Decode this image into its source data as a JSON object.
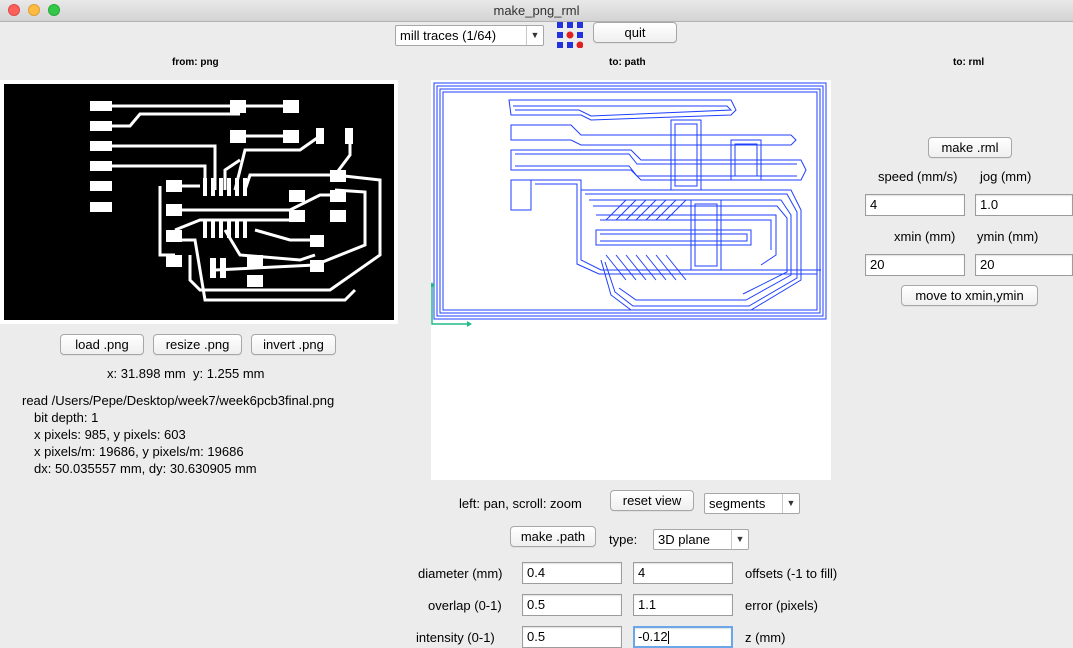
{
  "window": {
    "title": "make_png_rml"
  },
  "toolbar": {
    "process_select": "mill traces (1/64)",
    "quit_label": "quit"
  },
  "from_png": {
    "heading": "from: png",
    "buttons": {
      "load": "load .png",
      "resize": "resize .png",
      "invert": "invert .png"
    },
    "coords": "x: 31.898 mm  y: 1.255 mm",
    "info": [
      "read /Users/Pepe/Desktop/week7/week6pcb3final.png",
      "bit depth: 1",
      "x pixels: 985, y pixels: 603",
      "x pixels/m: 19686, y pixels/m: 19686",
      "dx: 50.035557 mm, dy: 30.630905 mm"
    ]
  },
  "to_path": {
    "heading": "to: path",
    "nav_hint": "left: pan, scroll: zoom",
    "reset_view": "reset view",
    "view_select": "segments",
    "make_path": "make .path",
    "type_label": "type:",
    "type_select": "3D plane",
    "diameter_label": "diameter (mm)",
    "diameter_value": "0.4",
    "offsets_value": "4",
    "offsets_label": "offsets (-1 to fill)",
    "overlap_label": "overlap (0-1)",
    "overlap_value": "0.5",
    "error_value": "1.1",
    "error_label": "error (pixels)",
    "intensity_label": "intensity (0-1)",
    "intensity_value": "0.5",
    "z_value": "-0.12",
    "z_label": "z (mm)"
  },
  "to_rml": {
    "heading": "to: rml",
    "make_rml": "make .rml",
    "speed_label": "speed (mm/s)",
    "speed_value": "4",
    "jog_label": "jog (mm)",
    "jog_value": "1.0",
    "xmin_label": "xmin (mm)",
    "xmin_value": "20",
    "ymin_label": "ymin (mm)",
    "ymin_value": "20",
    "move_button": "move to xmin,ymin"
  },
  "colors": {
    "toolpath": "#1f3fff",
    "axis": "#22bb88",
    "board": "#000000"
  }
}
